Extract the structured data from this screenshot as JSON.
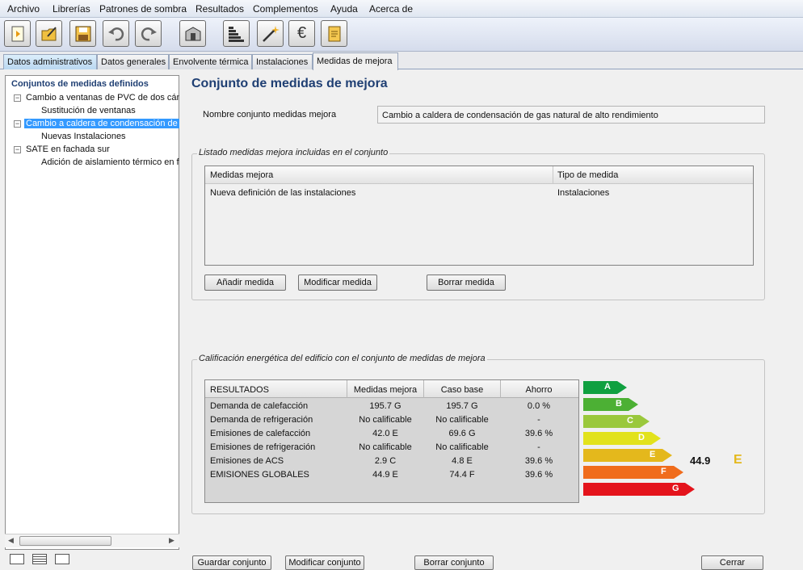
{
  "menu": [
    "Archivo",
    "Librerías",
    "Patrones de sombra",
    "Resultados",
    "Complementos",
    "Ayuda",
    "Acerca de"
  ],
  "toolbar": {
    "icons": [
      "new-file-icon",
      "open-folder-icon",
      "save-icon",
      "undo-icon",
      "redo-icon",
      "building-icon",
      "stairs-icon",
      "magic-wand-icon",
      "euro-icon",
      "report-icon"
    ],
    "euro_glyph": "€"
  },
  "tabs": [
    "Datos administrativos",
    "Datos generales",
    "Envolvente térmica",
    "Instalaciones",
    "Medidas de mejora"
  ],
  "tree": {
    "root": "Conjuntos de medidas definidos",
    "items": [
      {
        "label": "Cambio a ventanas de PVC de dos cáma",
        "child": "Sustitución de ventanas"
      },
      {
        "label": "Cambio a caldera de condensación de g",
        "child": "Nuevas Instalaciones"
      },
      {
        "label": "SATE en fachada sur",
        "child": "Adición de aislamiento térmico en fa"
      }
    ]
  },
  "heading": "Conjunto de medidas de mejora",
  "name_label": "Nombre conjunto medidas mejora",
  "name_value": "Cambio a caldera de condensación de gas natural de alto rendimiento",
  "list_group": "Listado medidas mejora incluidas en el conjunto",
  "list_cols": [
    "Medidas mejora",
    "Tipo de medida"
  ],
  "list_rows": [
    [
      "Nueva definición de las instalaciones",
      "Instalaciones"
    ]
  ],
  "buttons": {
    "add": "Añadir medida",
    "modify": "Modificar medida",
    "delete": "Borrar medida"
  },
  "calif_group": "Calificación energética del edificio con el conjunto de medidas de mejora",
  "results_cols": [
    "RESULTADOS",
    "Medidas mejora",
    "Caso base",
    "Ahorro"
  ],
  "results_rows": [
    [
      "Demanda de calefacción",
      "195.7 G",
      "195.7 G",
      "0.0 %"
    ],
    [
      "Demanda de refrigeración",
      "No calificable",
      "No calificable",
      "-"
    ],
    [
      "Emisiones de calefacción",
      "42.0 E",
      "69.6 G",
      "39.6 %"
    ],
    [
      "Emisiones de refrigeración",
      "No calificable",
      "No calificable",
      "-"
    ],
    [
      "Emisiones de ACS",
      "2.9 C",
      "4.8 E",
      "39.6 %"
    ],
    [
      "EMISIONES GLOBALES",
      "44.9 E",
      "74.4 F",
      "39.6 %"
    ]
  ],
  "scale": [
    {
      "letter": "A",
      "color": "#10a040"
    },
    {
      "letter": "B",
      "color": "#4cb034"
    },
    {
      "letter": "C",
      "color": "#9ac83c"
    },
    {
      "letter": "D",
      "color": "#e2e21c"
    },
    {
      "letter": "E",
      "color": "#e4b81c"
    },
    {
      "letter": "F",
      "color": "#f06c1c"
    },
    {
      "letter": "G",
      "color": "#e4141c"
    }
  ],
  "rating_value": "44.9",
  "rating_letter": "E",
  "rating_color": "#e4b81c",
  "bottom_buttons": [
    "Guardar conjunto",
    "Modificar conjunto",
    "Borrar conjunto",
    "Cerrar"
  ]
}
